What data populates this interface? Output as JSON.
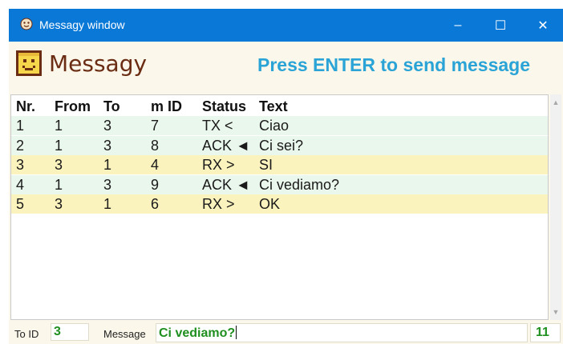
{
  "window": {
    "title": "Messagy window",
    "controls": {
      "minimize": "–",
      "maximize": "☐",
      "close": "✕"
    }
  },
  "header": {
    "app_name": "Messagy",
    "hint": "Press ENTER to send message"
  },
  "table": {
    "columns": [
      "Nr.",
      "From",
      "To",
      "m ID",
      "Status",
      "Text"
    ],
    "rows": [
      {
        "nr": "1",
        "from": "1",
        "to": "3",
        "mid": "7",
        "status": "TX <",
        "text": "Ciao",
        "bg": "#eaf7ec"
      },
      {
        "nr": "2",
        "from": "1",
        "to": "3",
        "mid": "8",
        "status": "ACK ◄",
        "text": "Ci sei?",
        "bg": "#eaf7ec"
      },
      {
        "nr": "3",
        "from": "3",
        "to": "1",
        "mid": "4",
        "status": "RX >",
        "text": "SI",
        "bg": "#fbf3bd"
      },
      {
        "nr": "4",
        "from": "1",
        "to": "3",
        "mid": "9",
        "status": "ACK ◄",
        "text": "Ci vediamo?",
        "bg": "#eaf7ec"
      },
      {
        "nr": "5",
        "from": "3",
        "to": "1",
        "mid": "6",
        "status": "RX >",
        "text": "OK",
        "bg": "#fbf3bd"
      }
    ]
  },
  "input": {
    "to_id_label": "To ID",
    "to_id_value": "3",
    "message_label": "Message",
    "message_value": "Ci vediamo?",
    "char_count": "11"
  },
  "colors": {
    "titlebar": "#0a78d7",
    "app_name": "#6b2c14",
    "hint": "#2aa3d6",
    "input_text": "#1f8f1f",
    "tx_row": "#eaf7ec",
    "rx_row": "#fbf3bd"
  },
  "icons": {
    "app": "messagy-app-icon",
    "logo": "messagy-logo-icon"
  }
}
